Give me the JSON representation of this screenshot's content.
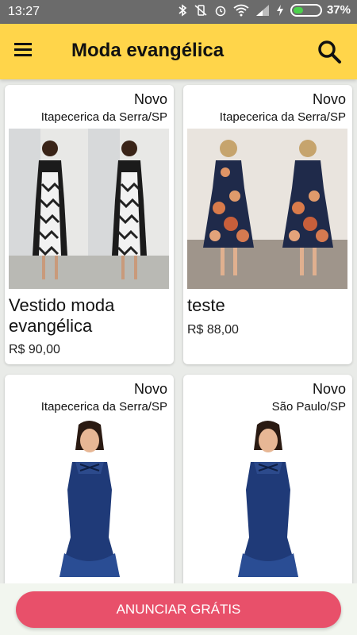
{
  "status_bar": {
    "time": "13:27",
    "battery_percent": "37%",
    "battery_level": 0.37
  },
  "app_bar": {
    "title": "Moda evangélica",
    "menu_icon": "menu-icon",
    "search_icon": "search-icon"
  },
  "listings": [
    {
      "badge": "Novo",
      "location": "Itapecerica da Serra/SP",
      "name": "Vestido moda evangélica",
      "price": "R$ 90,00",
      "image": "dress-photo-black-white-chevron"
    },
    {
      "badge": "Novo",
      "location": "Itapecerica da Serra/SP",
      "name": "teste",
      "price": "R$ 88,00",
      "image": "dress-photo-navy-floral"
    },
    {
      "badge": "Novo",
      "location": "Itapecerica da Serra/SP",
      "name": "",
      "price": "",
      "image": "dress-photo-denim-mermaid"
    },
    {
      "badge": "Novo",
      "location": "São Paulo/SP",
      "name": "",
      "price": "",
      "image": "dress-photo-denim-mermaid"
    }
  ],
  "footer": {
    "cta_label": "ANUNCIAR GRÁTIS"
  },
  "colors": {
    "app_bar": "#ffd54a",
    "cta": "#e8506a",
    "status_bar": "#6b6b6b",
    "background": "#e9ebe8"
  }
}
